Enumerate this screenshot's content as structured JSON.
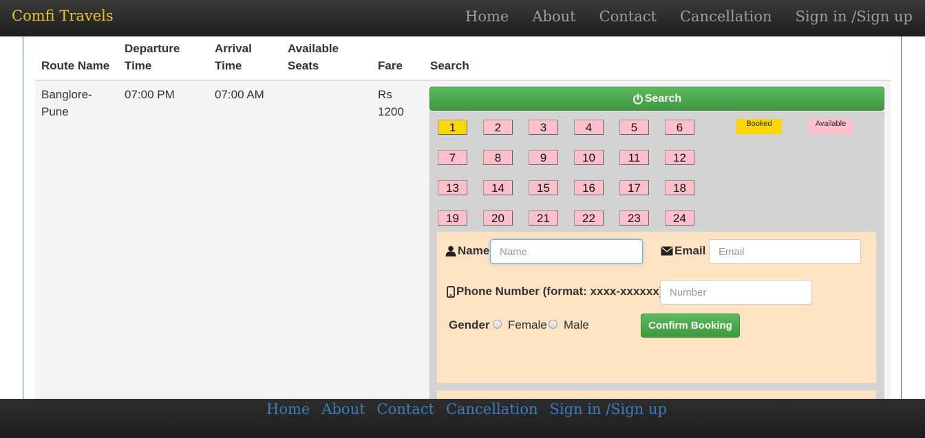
{
  "brand": "Comfi Travels",
  "nav": [
    "Home",
    "About",
    "Contact",
    "Cancellation",
    "Sign in /Sign up"
  ],
  "table": {
    "headers": {
      "route": [
        "Route Name"
      ],
      "departure": [
        "Departure",
        "Time"
      ],
      "arrival": [
        "Arrival",
        "Time"
      ],
      "seats": [
        "Available",
        "Seats"
      ],
      "fare": [
        "Fare"
      ],
      "search": [
        "Search"
      ]
    },
    "row": {
      "route": [
        "Banglore-",
        "Pune"
      ],
      "departure": "07:00 PM",
      "arrival": "07:00 AM",
      "fare": [
        "Rs",
        "1200"
      ]
    }
  },
  "search_button": "Search",
  "seats": [
    {
      "no": "1",
      "status": "booked"
    },
    {
      "no": "2",
      "status": "available"
    },
    {
      "no": "3",
      "status": "available"
    },
    {
      "no": "4",
      "status": "available"
    },
    {
      "no": "5",
      "status": "available"
    },
    {
      "no": "6",
      "status": "available"
    },
    {
      "no": "7",
      "status": "available"
    },
    {
      "no": "8",
      "status": "available"
    },
    {
      "no": "9",
      "status": "available"
    },
    {
      "no": "10",
      "status": "available"
    },
    {
      "no": "11",
      "status": "available"
    },
    {
      "no": "12",
      "status": "available"
    },
    {
      "no": "13",
      "status": "available"
    },
    {
      "no": "14",
      "status": "available"
    },
    {
      "no": "15",
      "status": "available"
    },
    {
      "no": "16",
      "status": "available"
    },
    {
      "no": "17",
      "status": "available"
    },
    {
      "no": "18",
      "status": "available"
    },
    {
      "no": "19",
      "status": "available"
    },
    {
      "no": "20",
      "status": "available"
    },
    {
      "no": "21",
      "status": "available"
    },
    {
      "no": "22",
      "status": "available"
    },
    {
      "no": "23",
      "status": "available"
    },
    {
      "no": "24",
      "status": "available"
    }
  ],
  "legend": {
    "booked": "Booked",
    "available": "Available"
  },
  "colors": {
    "booked": "#ffd700",
    "available": "#ffc0cb",
    "brand": "#f0c030",
    "button": "#5cb85c",
    "form_bg": "#ffe4c4"
  },
  "icons": {
    "search": "power-icon",
    "name": "user-icon",
    "email": "envelope-icon",
    "phone": "phone-icon"
  },
  "form": {
    "name_label": "Name",
    "name_placeholder": "Name",
    "email_label": "Email",
    "email_placeholder": "Email",
    "phone_label": "Phone Number (format: xxxx-xxxxxx)",
    "phone_placeholder": "Number",
    "gender_label": "Gender",
    "female_label": "Female",
    "male_label": "Male",
    "confirm_button": "Confirm Booking"
  },
  "footer_nav": [
    "Home",
    "About",
    "Contact",
    "Cancellation",
    "Sign in /Sign up"
  ]
}
